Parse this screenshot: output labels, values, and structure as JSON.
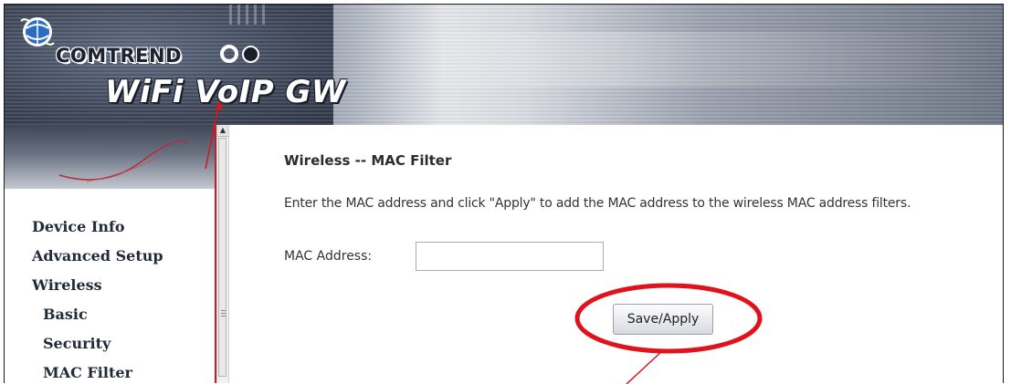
{
  "banner": {
    "brand": "COMTREND",
    "product": "WiFi VoIP GW"
  },
  "nav": {
    "items": [
      {
        "label": "Device Info",
        "level": 1
      },
      {
        "label": "Advanced Setup",
        "level": 1
      },
      {
        "label": "Wireless",
        "level": 1
      },
      {
        "label": "Basic",
        "level": 2
      },
      {
        "label": "Security",
        "level": 2
      },
      {
        "label": "MAC Filter",
        "level": 2
      }
    ]
  },
  "main": {
    "title": "Wireless -- MAC Filter",
    "description": "Enter the MAC address and click \"Apply\" to add the MAC address to the wireless MAC address filters.",
    "mac_label": "MAC Address:",
    "mac_value": "",
    "save_label": "Save/Apply"
  },
  "colors": {
    "annotation": "#e0121b",
    "nav_divider": "#c21f2b",
    "text": "#333333"
  },
  "icons": [
    "comtrend-logo-icon",
    "scroll-up-icon",
    "scroll-grip-icon"
  ]
}
